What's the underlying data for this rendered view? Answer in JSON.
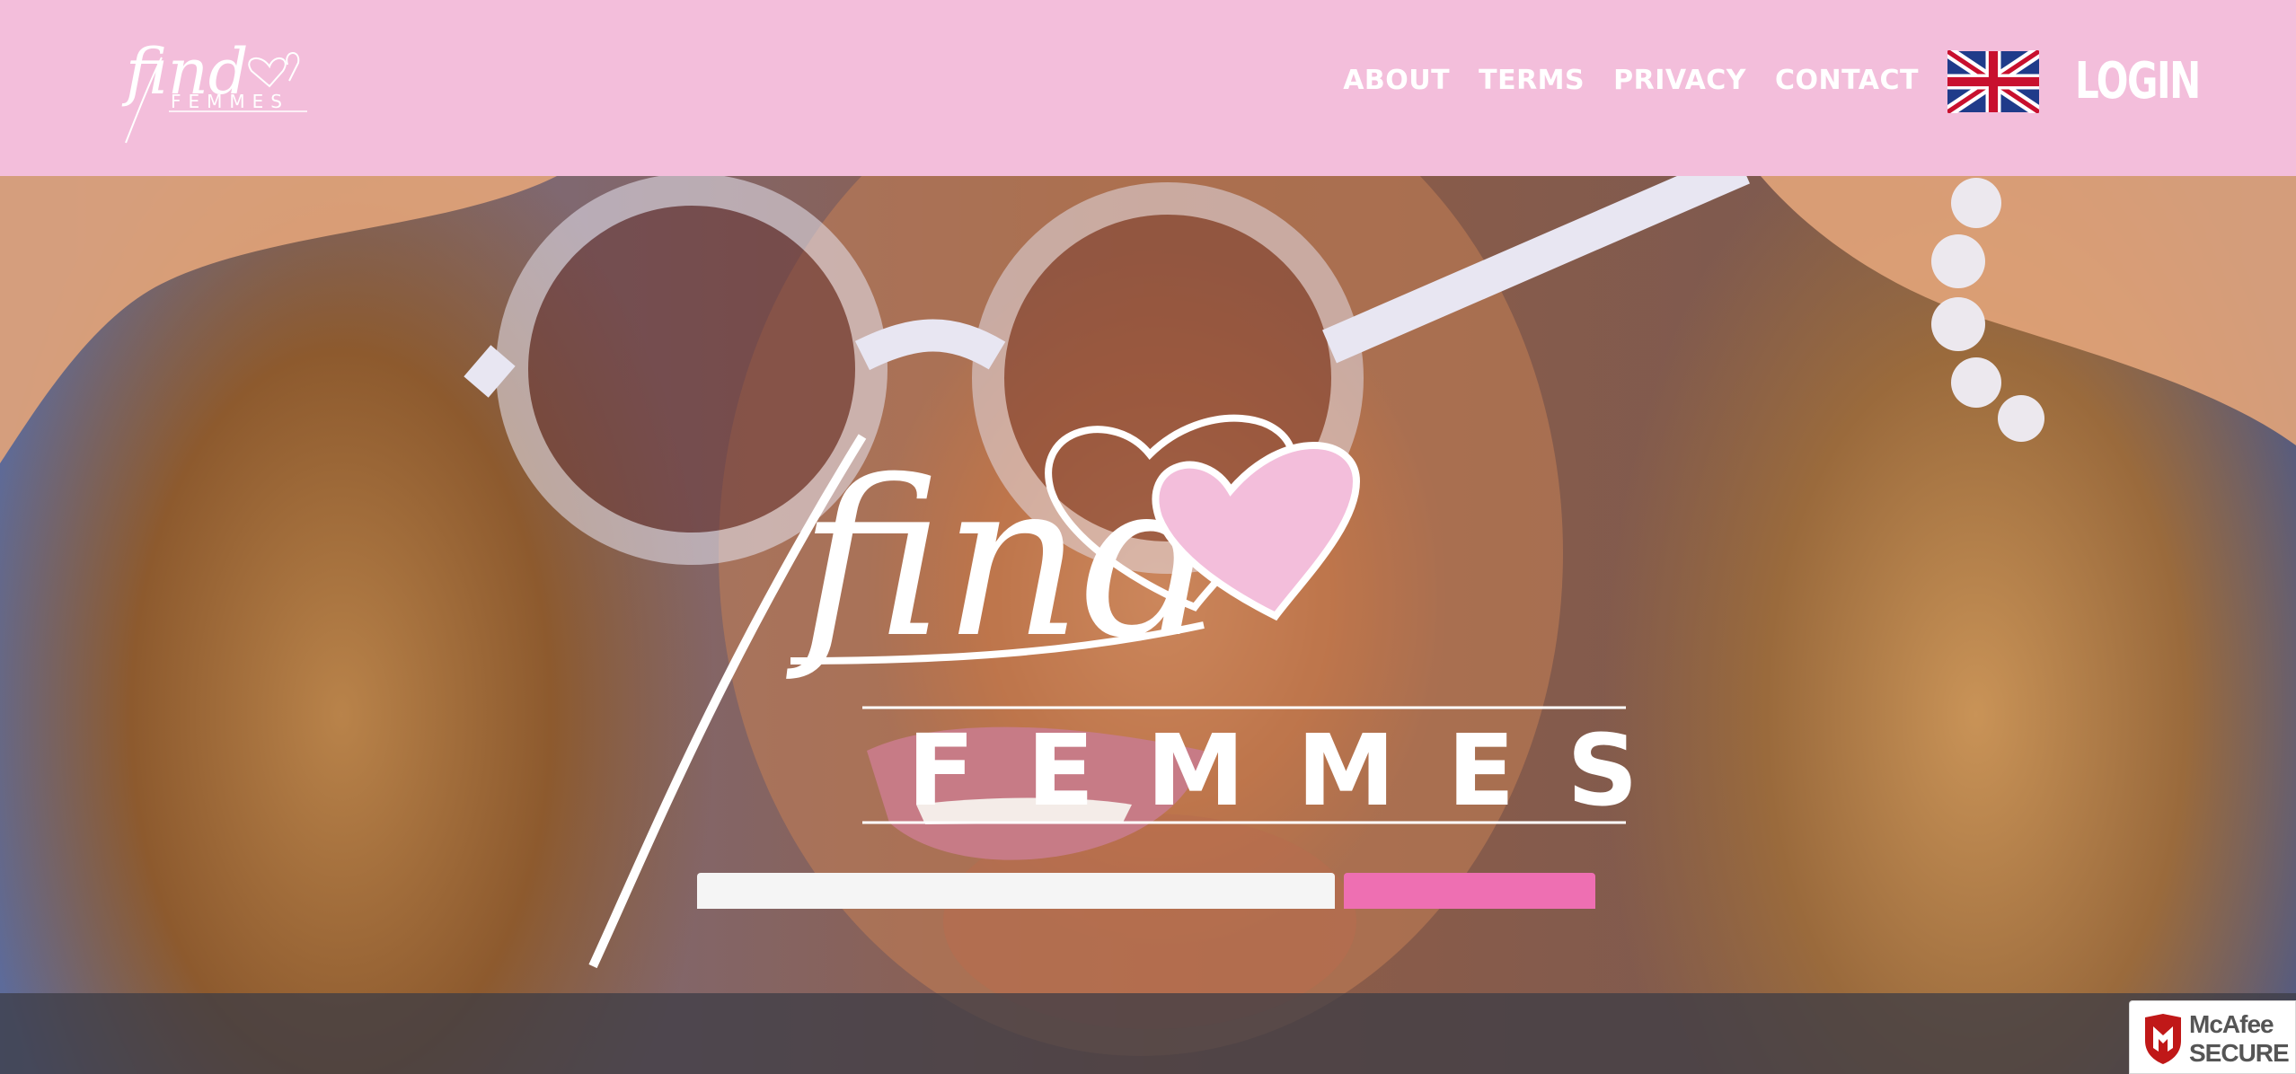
{
  "header": {
    "logo": {
      "word1": "find",
      "word2": "FEMMES"
    },
    "nav": [
      {
        "label": "ABOUT"
      },
      {
        "label": "TERMS"
      },
      {
        "label": "PRIVACY"
      },
      {
        "label": "CONTACT"
      }
    ],
    "language_flag": "uk-flag-icon",
    "login_label": "LOGIN"
  },
  "hero": {
    "logo": {
      "word1": "find",
      "word2": "FEMMES"
    }
  },
  "badge": {
    "line1": "McAfee",
    "line2": "SECURE"
  },
  "colors": {
    "brand_pink": "#f3bedb",
    "accent_pink": "#ee6fb2",
    "white": "#ffffff"
  }
}
